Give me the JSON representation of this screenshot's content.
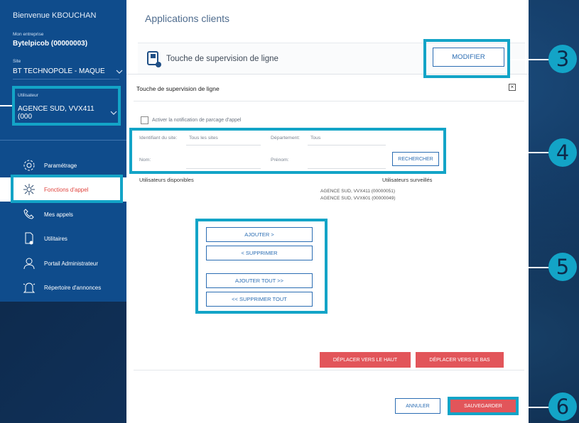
{
  "sidebar": {
    "welcome": "Bienvenue KBOUCHAN",
    "company_label": "Mon entreprise",
    "company_value": "Bytelpicob (00000003)",
    "site_label": "Site",
    "site_value": "BT TECHNOPOLE - MAQUE",
    "user_label": "Utilisateur",
    "user_value": "AGENCE SUD, VVX411 (000",
    "nav": [
      {
        "label": "Paramétrage",
        "icon": "gear-icon"
      },
      {
        "label": "Fonctions d'appel",
        "icon": "call-functions-icon"
      },
      {
        "label": "Mes appels",
        "icon": "phone-icon"
      },
      {
        "label": "Utilitaires",
        "icon": "utilities-icon"
      },
      {
        "label": "Portail Administrateur",
        "icon": "admin-user-icon"
      },
      {
        "label": "Répertoire d'annonces",
        "icon": "bell-icon"
      }
    ]
  },
  "main": {
    "title": "Applications clients",
    "header_title": "Touche de supervision de ligne",
    "modify_label": "MODIFIER"
  },
  "dialog": {
    "title": "Touche de supervision de ligne",
    "close_glyph": "×",
    "checkbox_label": "Activer la notification de parcage d'appel",
    "site_label": "Identifiant du site:",
    "site_value": "Tous les sites",
    "dept_label": "Département:",
    "dept_value": "Tous",
    "nom_label": "Nom:",
    "prenom_label": "Prénom:",
    "search_label": "RECHERCHER",
    "available_head": "Utilisateurs disponibles",
    "watched_head": "Utilisateurs surveillés",
    "watched": [
      "AGENCE SUD, VVX411 (00000051)",
      "AGENCE SUD, VVX601 (00000049)"
    ],
    "add_label": "AJOUTER >",
    "remove_label": "< SUPPRIMER",
    "add_all_label": "AJOUTER TOUT >>",
    "remove_all_label": "<< SUPPRIMER TOUT",
    "move_up_label": "DÉPLACER VERS LE HAUT",
    "move_down_label": "DÉPLACER VERS LE BAS",
    "cancel_label": "ANNULER",
    "save_label": "SAUVEGARDER"
  },
  "callouts": [
    "3",
    "4",
    "5",
    "6"
  ],
  "colors": {
    "sidebar": "#0f4c8c",
    "accent": "#2b6db3",
    "highlight": "#13a4c7",
    "danger": "#e2555a"
  }
}
